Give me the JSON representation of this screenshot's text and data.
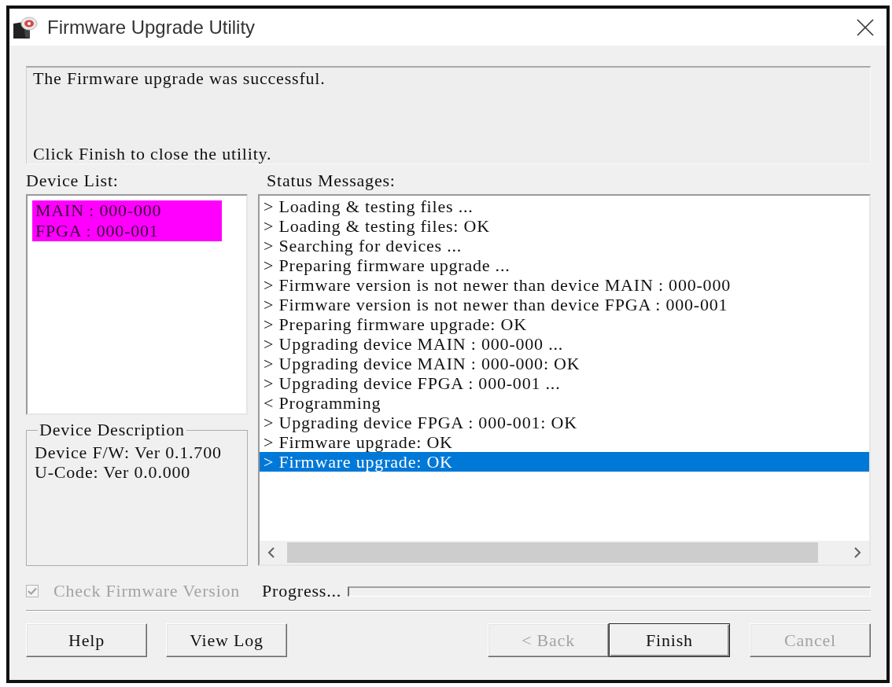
{
  "window": {
    "title": "Firmware Upgrade Utility"
  },
  "message_panel": {
    "lines": [
      "The Firmware upgrade was successful.",
      "Click Finish to close the utility."
    ]
  },
  "device_list": {
    "label": "Device List:",
    "items": [
      {
        "text": "MAIN : 000-000",
        "selected": true
      },
      {
        "text": "FPGA : 000-001",
        "selected": true
      }
    ]
  },
  "device_description": {
    "title": "Device Description",
    "lines": [
      "Device F/W: Ver 0.1.700",
      "U-Code: Ver 0.0.000"
    ]
  },
  "status_messages": {
    "label": "Status Messages:",
    "items": [
      {
        "text": "> Loading & testing files ...",
        "selected": false
      },
      {
        "text": "> Loading & testing files: OK",
        "selected": false
      },
      {
        "text": "> Searching for devices ...",
        "selected": false
      },
      {
        "text": "> Preparing firmware upgrade ...",
        "selected": false
      },
      {
        "text": "> Firmware version is not newer than device MAIN : 000-000",
        "selected": false
      },
      {
        "text": "> Firmware version is not newer than device FPGA : 000-001",
        "selected": false
      },
      {
        "text": "> Preparing firmware upgrade: OK",
        "selected": false
      },
      {
        "text": "> Upgrading device MAIN : 000-000 ...",
        "selected": false
      },
      {
        "text": "> Upgrading device MAIN : 000-000: OK",
        "selected": false
      },
      {
        "text": "> Upgrading device FPGA : 000-001 ...",
        "selected": false
      },
      {
        "text": "< Programming",
        "selected": false
      },
      {
        "text": "> Upgrading device FPGA : 000-001: OK",
        "selected": false
      },
      {
        "text": "> Firmware upgrade: OK",
        "selected": false
      },
      {
        "text": "> Firmware upgrade: OK",
        "selected": true
      }
    ]
  },
  "check_firmware_version": {
    "label": "Check Firmware Version",
    "checked": true,
    "disabled": true
  },
  "progress": {
    "label": "Progress...",
    "level": 0
  },
  "footer": {
    "left_buttons": [
      {
        "label": "Help",
        "disabled": false,
        "default": false
      },
      {
        "label": "View Log",
        "disabled": false,
        "default": false
      }
    ],
    "right_buttons": [
      {
        "label": "< Back",
        "disabled": true,
        "default": false
      },
      {
        "label": "Finish",
        "disabled": false,
        "default": true
      },
      {
        "label": "Cancel",
        "disabled": true,
        "default": false
      }
    ]
  }
}
